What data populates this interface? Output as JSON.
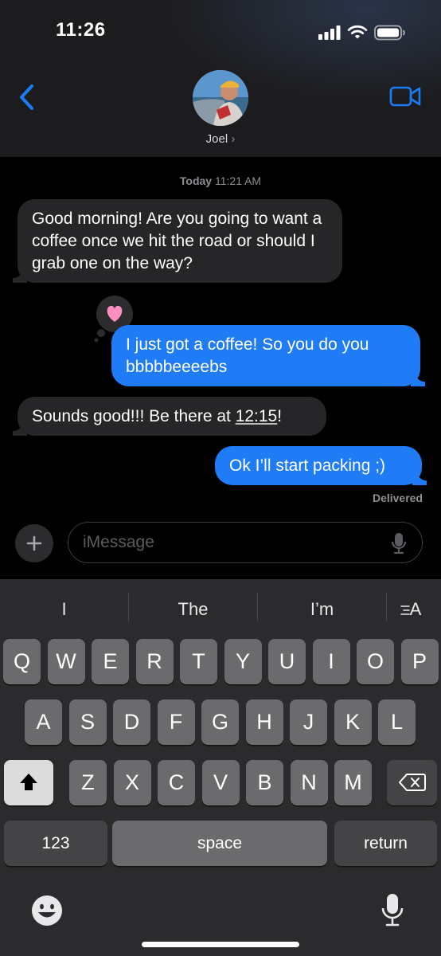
{
  "status_bar": {
    "time": "11:26"
  },
  "header": {
    "contact_name": "Joel",
    "chevron": "›"
  },
  "thread": {
    "timestamp_day": "Today",
    "timestamp_time": "11:21 AM",
    "messages": [
      {
        "direction": "incoming",
        "text": "Good morning!  Are you going to want a coffee once we hit the road or should I grab one on the way?"
      },
      {
        "direction": "outgoing",
        "text": "I just got a coffee! So you do you bbbbbeeeebs",
        "tapback": "heart"
      },
      {
        "direction": "incoming",
        "text_before": "Sounds good!!! Be there at ",
        "link": "12:15",
        "text_after": "!"
      },
      {
        "direction": "outgoing",
        "text": "Ok I’ll start packing ;)"
      }
    ],
    "status": "Delivered"
  },
  "composer": {
    "placeholder": "iMessage",
    "plus_label": "+"
  },
  "keyboard": {
    "suggestions": [
      "I",
      "The",
      "I’m"
    ],
    "format_label": "A",
    "row1": [
      "Q",
      "W",
      "E",
      "R",
      "T",
      "Y",
      "U",
      "I",
      "O",
      "P"
    ],
    "row2": [
      "A",
      "S",
      "D",
      "F",
      "G",
      "H",
      "J",
      "K",
      "L"
    ],
    "row3": [
      "Z",
      "X",
      "C",
      "V",
      "B",
      "N",
      "M"
    ],
    "numbers_label": "123",
    "space_label": "space",
    "return_label": "return"
  },
  "colors": {
    "outgoing_bubble": "#1f7cf6",
    "incoming_bubble": "#262629",
    "accent": "#1a7cf5"
  }
}
